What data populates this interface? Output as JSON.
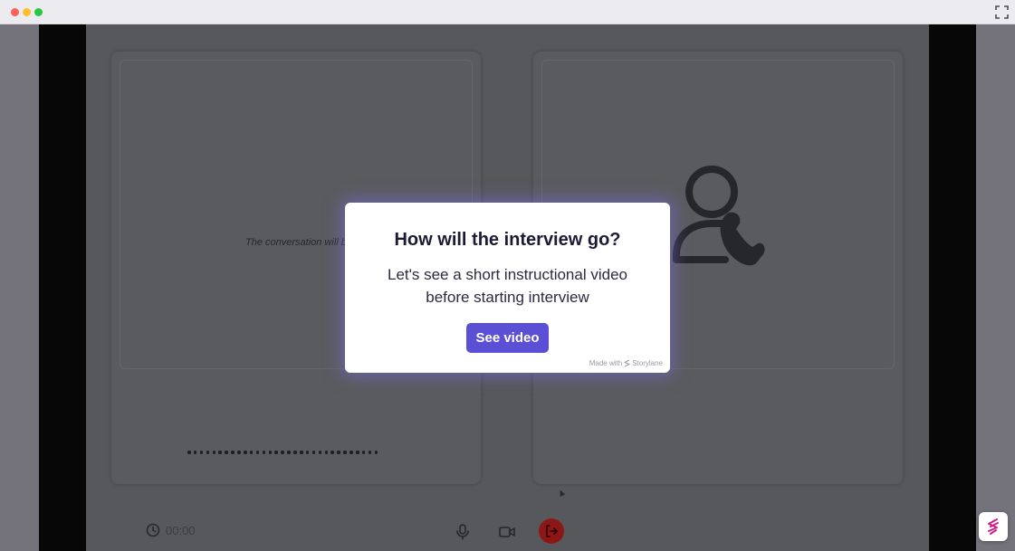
{
  "window": {
    "controls": [
      "close",
      "minimize",
      "maximize"
    ],
    "fullscreen_icon": "fullscreen-icon"
  },
  "left_panel": {
    "conversation_text": "The conversation will begin"
  },
  "right_panel": {
    "icon": "user-phone-icon"
  },
  "controls": {
    "timer": "00:00",
    "timer_icon": "clock-icon",
    "mic_icon": "microphone-icon",
    "camera_icon": "camera-icon",
    "leave_icon": "leave-icon",
    "leave_color": "#8d1716"
  },
  "modal": {
    "title": "How will the interview go?",
    "body": "Let's see a short instructional video before starting interview",
    "button": "See video",
    "made_with": "Made with",
    "brand": "Storylane",
    "accent_color": "#5b4fd6"
  },
  "badge": {
    "icon": "storylane-logo-icon"
  }
}
